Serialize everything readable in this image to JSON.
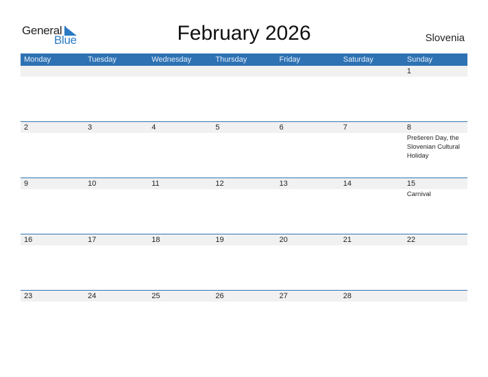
{
  "brand": {
    "general": "General",
    "blue": "Blue"
  },
  "header": {
    "title": "February 2026",
    "country": "Slovenia"
  },
  "colors": {
    "accent": "#2e72b4",
    "band": "#f1f1f1",
    "logo_blue": "#2a7bc4"
  },
  "weekdays": [
    "Monday",
    "Tuesday",
    "Wednesday",
    "Thursday",
    "Friday",
    "Saturday",
    "Sunday"
  ],
  "weeks": [
    {
      "days": [
        {
          "num": "",
          "event": ""
        },
        {
          "num": "",
          "event": ""
        },
        {
          "num": "",
          "event": ""
        },
        {
          "num": "",
          "event": ""
        },
        {
          "num": "",
          "event": ""
        },
        {
          "num": "",
          "event": ""
        },
        {
          "num": "1",
          "event": ""
        }
      ]
    },
    {
      "days": [
        {
          "num": "2",
          "event": ""
        },
        {
          "num": "3",
          "event": ""
        },
        {
          "num": "4",
          "event": ""
        },
        {
          "num": "5",
          "event": ""
        },
        {
          "num": "6",
          "event": ""
        },
        {
          "num": "7",
          "event": ""
        },
        {
          "num": "8",
          "event": "Prešeren Day, the Slovenian Cultural Holiday"
        }
      ]
    },
    {
      "days": [
        {
          "num": "9",
          "event": ""
        },
        {
          "num": "10",
          "event": ""
        },
        {
          "num": "11",
          "event": ""
        },
        {
          "num": "12",
          "event": ""
        },
        {
          "num": "13",
          "event": ""
        },
        {
          "num": "14",
          "event": ""
        },
        {
          "num": "15",
          "event": "Carnival"
        }
      ]
    },
    {
      "days": [
        {
          "num": "16",
          "event": ""
        },
        {
          "num": "17",
          "event": ""
        },
        {
          "num": "18",
          "event": ""
        },
        {
          "num": "19",
          "event": ""
        },
        {
          "num": "20",
          "event": ""
        },
        {
          "num": "21",
          "event": ""
        },
        {
          "num": "22",
          "event": ""
        }
      ]
    },
    {
      "days": [
        {
          "num": "23",
          "event": ""
        },
        {
          "num": "24",
          "event": ""
        },
        {
          "num": "25",
          "event": ""
        },
        {
          "num": "26",
          "event": ""
        },
        {
          "num": "27",
          "event": ""
        },
        {
          "num": "28",
          "event": ""
        },
        {
          "num": "",
          "event": ""
        }
      ]
    }
  ]
}
